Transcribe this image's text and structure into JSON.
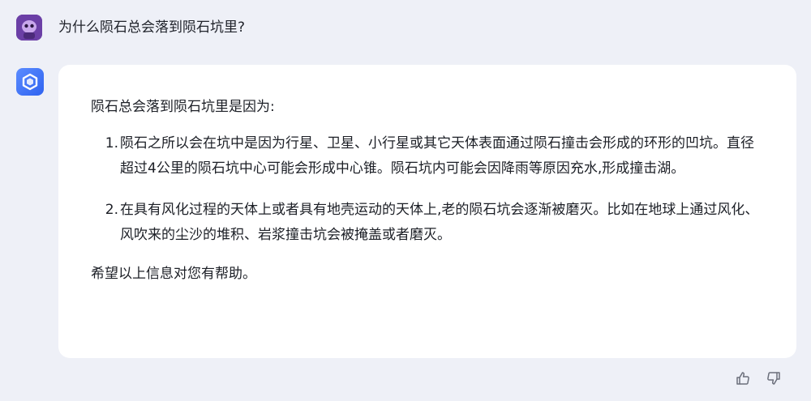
{
  "question": {
    "text": "为什么陨石总会落到陨石坑里?"
  },
  "answer": {
    "intro": "陨石总会落到陨石坑里是因为:",
    "items": [
      {
        "num": "1.",
        "text": "陨石之所以会在坑中是因为行星、卫星、小行星或其它天体表面通过陨石撞击会形成的环形的凹坑。直径超过4公里的陨石坑中心可能会形成中心锥。陨石坑内可能会因降雨等原因充水,形成撞击湖。"
      },
      {
        "num": "2.",
        "text": "在具有风化过程的天体上或者具有地壳运动的天体上,老的陨石坑会逐渐被磨灭。比如在地球上通过风化、风吹来的尘沙的堆积、岩浆撞击坑会被掩盖或者磨灭。"
      }
    ],
    "closing": "希望以上信息对您有帮助。"
  },
  "icons": {
    "user_avatar": "avatar-icon",
    "bot_logo": "bot-logo-icon",
    "like": "thumbs-up-icon",
    "dislike": "thumbs-down-icon"
  },
  "colors": {
    "background": "#eef0f7",
    "card": "#ffffff",
    "bot_accent": "#3a6cf4",
    "avatar": "#6b3fa6"
  }
}
